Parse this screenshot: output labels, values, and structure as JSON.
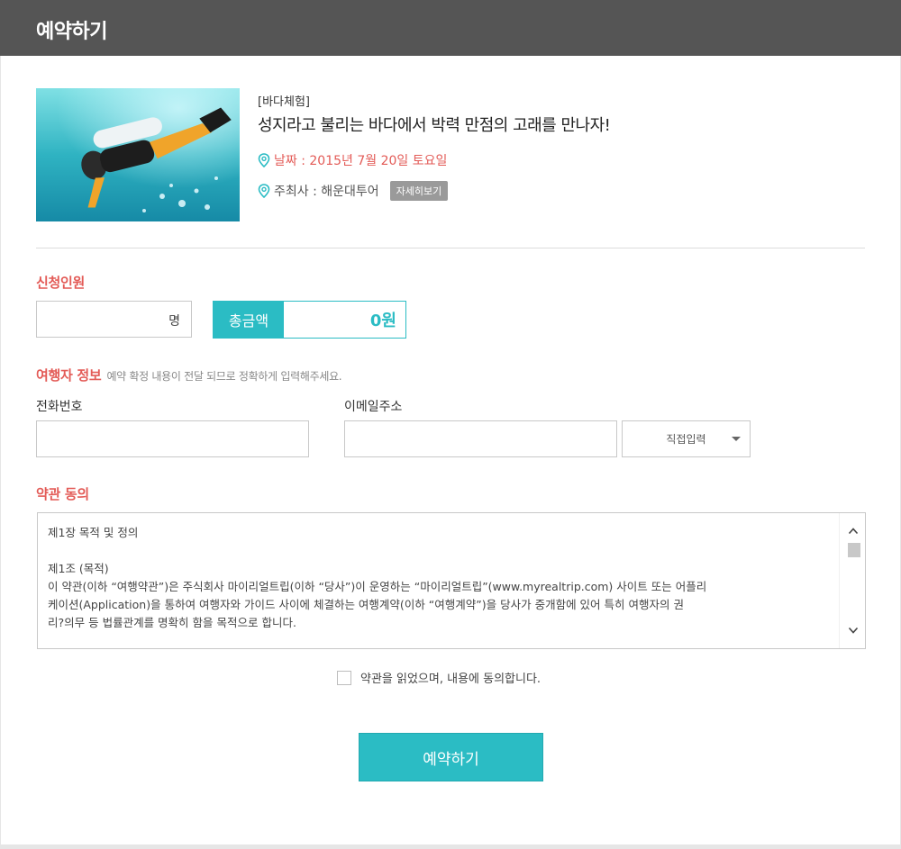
{
  "window": {
    "title": "예약하기"
  },
  "event": {
    "category": "[바다체험]",
    "title": "성지라고 불리는 바다에서 박력 만점의 고래를 만나자!",
    "date": "날짜 : 2015년 7월 20일 토요일",
    "host": "주최사 : 해운대투어",
    "detail_button": "자세히보기"
  },
  "applicants": {
    "label": "신청인원",
    "count_value": "",
    "unit": "명",
    "total_label": "총금액",
    "total_value": "0원"
  },
  "traveler": {
    "label": "여행자 정보",
    "note": "예약 확정 내용이 전달 되므로 정확하게 입력해주세요.",
    "phone_label": "전화번호",
    "phone_value": "",
    "email_label": "이메일주소",
    "email_value": "",
    "email_domain_selected": "직접입력"
  },
  "terms": {
    "label": "약관 동의",
    "text": "제1장 목적 및 정의\n\n제1조 (목적)\n이 약관(이하 “여행약관”)은 주식회사 마이리얼트립(이하 “당사”)이 운영하는 “마이리얼트립”(www.myrealtrip.com) 사이트 또는 어플리\n케이션(Application)을 통하여 여행자와 가이드 사이에 체결하는 여행계약(이하 “여행계약”)을 당사가 중개함에 있어 특히 여행자의 권\n리?의무 등 법률관계를 명확히 함을 목적으로 합니다.",
    "agree_label": "약관을 읽었으며, 내용에 동의합니다.",
    "agreed": false
  },
  "submit_label": "예약하기",
  "colors": {
    "accent": "#2bbcc4",
    "highlight": "#e35b57",
    "titlebar": "#555555"
  },
  "icons": {
    "location": "location-pin-icon",
    "scroll_up": "chevron-up-icon",
    "scroll_down": "chevron-down-icon",
    "dropdown": "caret-down-icon"
  }
}
